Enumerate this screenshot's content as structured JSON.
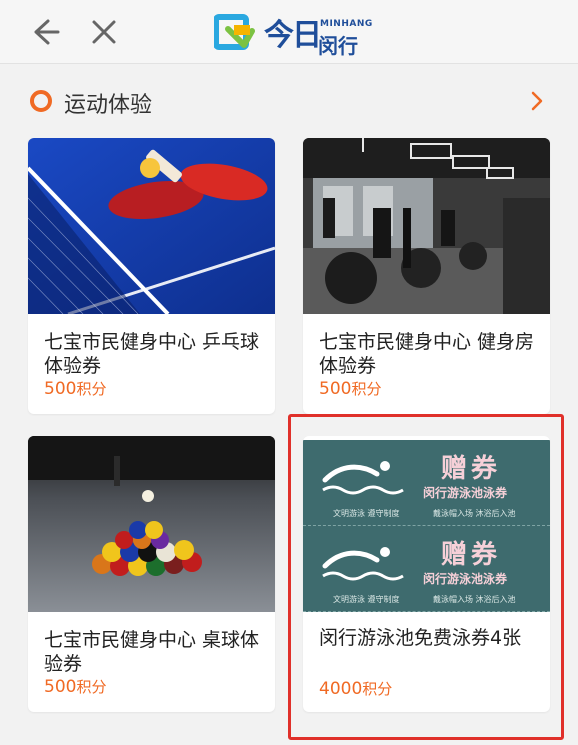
{
  "header": {
    "logo_script": "今日",
    "logo_en": "MINHANG",
    "logo_cn": "闵行"
  },
  "section": {
    "title": "运动体验"
  },
  "cards": [
    {
      "title": "七宝市民健身中心 乒乓球体验券",
      "points": "500",
      "unit": "积分"
    },
    {
      "title": "七宝市民健身中心 健身房体验券",
      "points": "500",
      "unit": "积分"
    },
    {
      "title": "七宝市民健身中心 桌球体验券",
      "points": "500",
      "unit": "积分"
    },
    {
      "title": "闵行游泳池免费泳券4张",
      "points": "4000",
      "unit": "积分"
    }
  ],
  "voucher": {
    "title": "赠券",
    "subtitle": "闵行游泳池泳券",
    "small_left": "文明游泳  遵守制度",
    "small_right": "戴泳帽入场  沐浴后入池"
  },
  "colors": {
    "accent": "#f06a24",
    "highlight": "#e0302a",
    "brand": "#1f4e9a"
  }
}
